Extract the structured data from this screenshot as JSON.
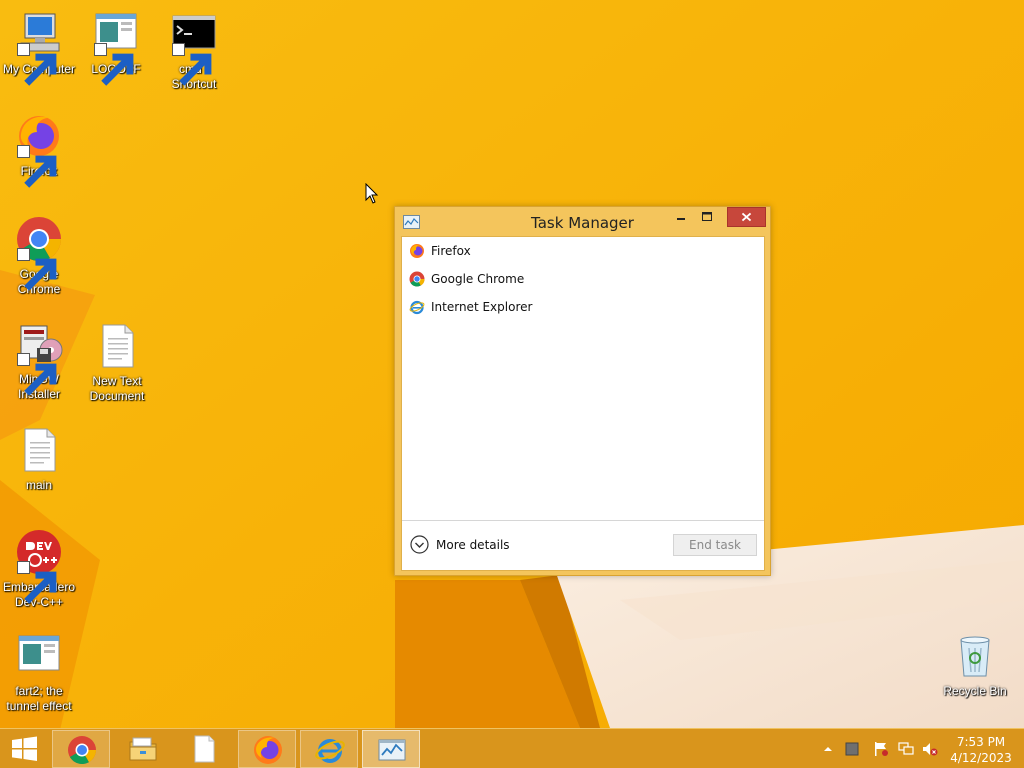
{
  "desktop": {
    "icons": [
      {
        "label": "My Computer"
      },
      {
        "label": "LOGOFF"
      },
      {
        "label": "cmd - Shortcut"
      },
      {
        "label": "Firefox"
      },
      {
        "label": "Google Chrome"
      },
      {
        "label": "MinGW Installer"
      },
      {
        "label": "New Text Document"
      },
      {
        "label": "main"
      },
      {
        "label": "Embarcadero Dev-C++"
      },
      {
        "label": "fart2; the tunnel effect"
      },
      {
        "label": "Recycle Bin"
      }
    ]
  },
  "task_manager": {
    "title": "Task Manager",
    "apps": [
      {
        "name": "Firefox",
        "icon": "firefox-icon"
      },
      {
        "name": "Google Chrome",
        "icon": "chrome-icon"
      },
      {
        "name": "Internet Explorer",
        "icon": "ie-icon"
      }
    ],
    "more_details_label": "More details",
    "end_task_label": "End task"
  },
  "taskbar": {
    "pinned": [
      {
        "icon": "chrome-icon"
      },
      {
        "icon": "file-explorer-icon"
      },
      {
        "icon": "document-icon"
      },
      {
        "icon": "firefox-icon"
      },
      {
        "icon": "ie-icon"
      },
      {
        "icon": "task-manager-icon"
      }
    ],
    "clock_time": "7:53 PM",
    "clock_date": "4/12/2023"
  },
  "colors": {
    "wallpaper_base": "#f7b400",
    "taskbar": "#d9951c",
    "window_frame": "#f4c55c",
    "close_button": "#c7473b"
  }
}
